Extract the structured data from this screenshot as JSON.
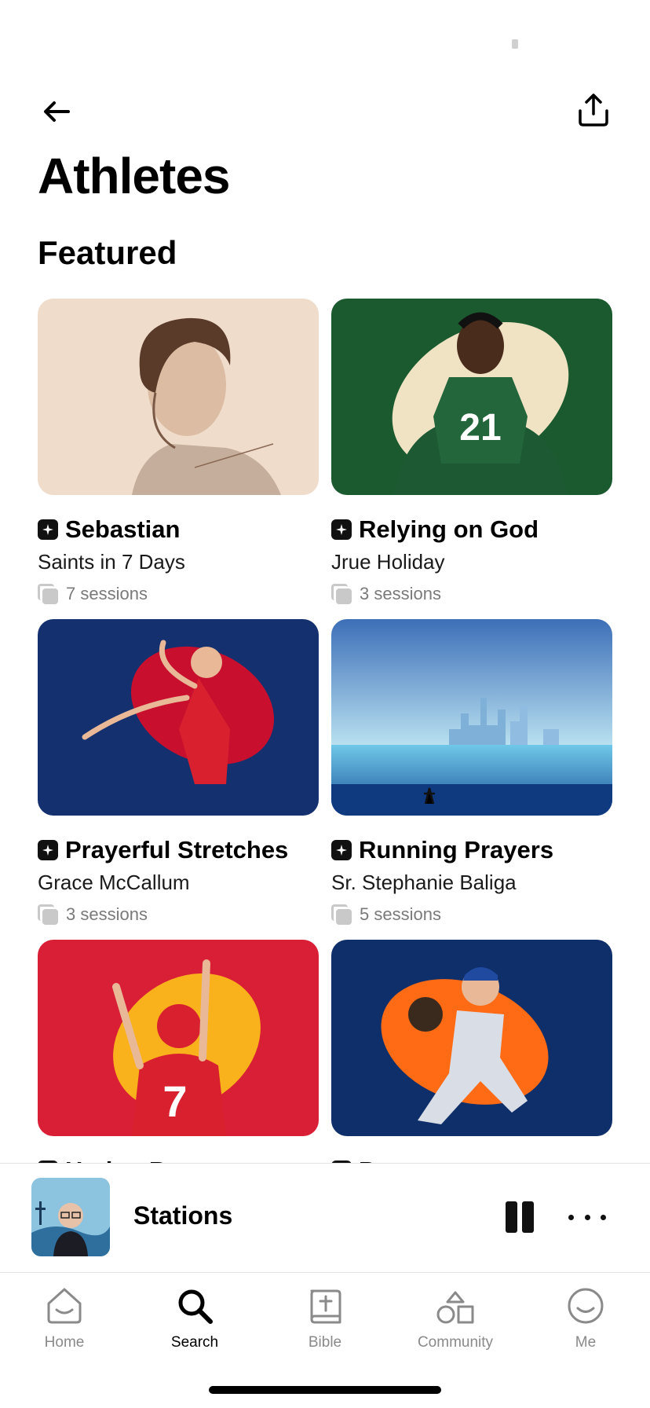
{
  "header": {
    "title": "Athletes",
    "section_title": "Featured"
  },
  "cards": [
    {
      "title": "Sebastian",
      "subtitle": "Saints in 7 Days",
      "sessions": "7 sessions"
    },
    {
      "title": "Relying on God",
      "subtitle": "Jrue Holiday",
      "sessions": "3 sessions",
      "jersey_number": "21"
    },
    {
      "title": "Prayerful Stretches",
      "subtitle": "Grace McCallum",
      "sessions": "3 sessions"
    },
    {
      "title": "Running Prayers",
      "subtitle": "Sr. Stephanie Baliga",
      "sessions": "5 sessions"
    },
    {
      "title": "Harker B...",
      "subtitle": "",
      "sessions": "",
      "jersey_number": "7"
    },
    {
      "title": "P...",
      "subtitle": "",
      "sessions": ""
    }
  ],
  "player": {
    "title": "Stations",
    "state": "playing"
  },
  "tabs": [
    {
      "label": "Home",
      "icon": "home-smile-icon",
      "active": false
    },
    {
      "label": "Search",
      "icon": "search-icon",
      "active": true
    },
    {
      "label": "Bible",
      "icon": "bible-icon",
      "active": false
    },
    {
      "label": "Community",
      "icon": "community-icon",
      "active": false
    },
    {
      "label": "Me",
      "icon": "profile-smile-icon",
      "active": false
    }
  ],
  "colors": {
    "accent": "#000000",
    "inactive": "#8a8a8a",
    "card1_bg": "#ecd6c2",
    "card2_bg": "#1b5a2f",
    "card3_bg": "#14306e",
    "card4_bg": "#4a86c8",
    "card5_bg": "#d91f36",
    "card6_bg": "#0f2f6a"
  }
}
